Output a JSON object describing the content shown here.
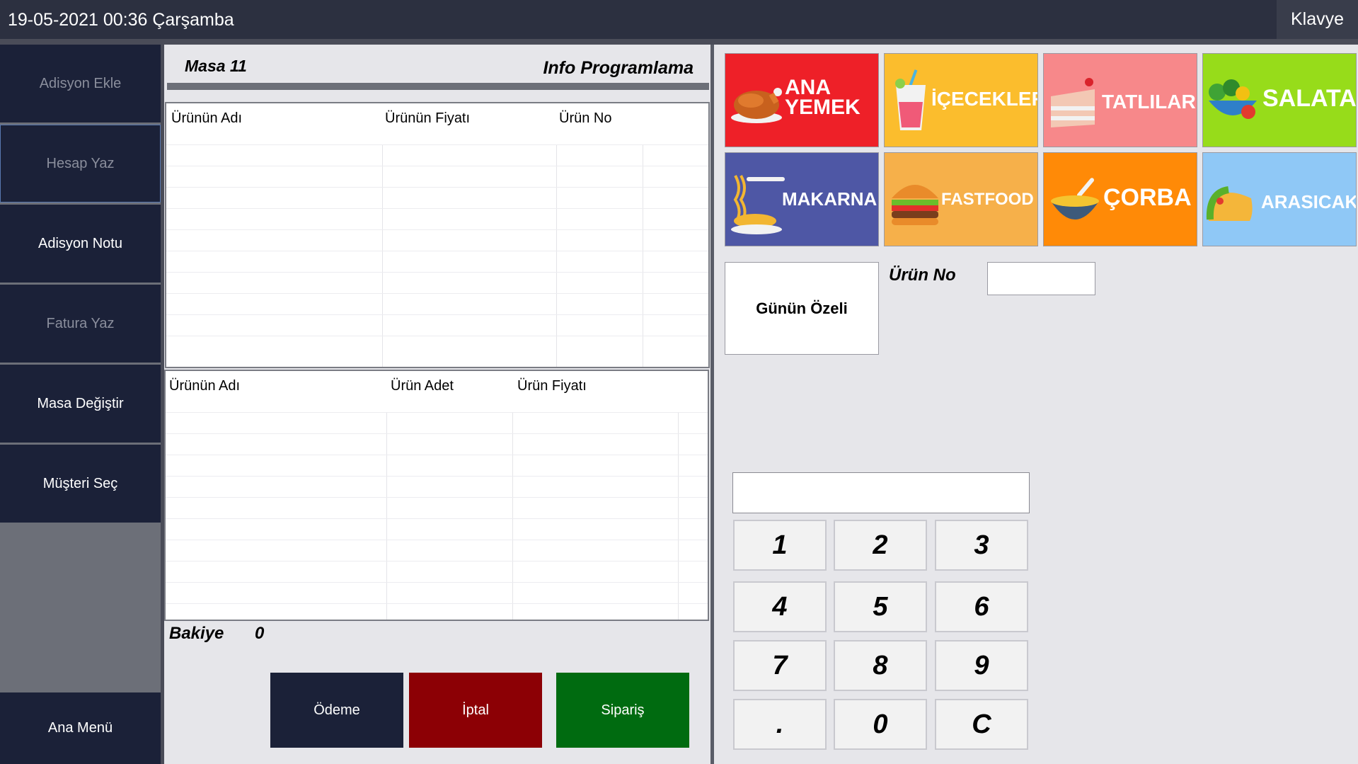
{
  "topbar": {
    "datetime": "19-05-2021 00:36 Çarşamba",
    "keyboard_label": "Klavye"
  },
  "sidebar": {
    "items": [
      {
        "label": "Adisyon Ekle"
      },
      {
        "label": "Hesap Yaz"
      },
      {
        "label": "Adisyon Notu"
      },
      {
        "label": "Fatura Yaz"
      },
      {
        "label": "Masa Değiştir"
      },
      {
        "label": "Müşteri Seç"
      }
    ],
    "main_menu_label": "Ana Menü"
  },
  "info": {
    "table": "Masa 11",
    "company": "Info Programlama"
  },
  "products_grid": {
    "columns": [
      "Ürünün Adı",
      "Ürünün Fiyatı",
      "Ürün No"
    ]
  },
  "order_grid": {
    "columns": [
      "Ürünün Adı",
      "Ürün Adet",
      "Ürün Fiyatı"
    ]
  },
  "balance": {
    "label": "Bakiye",
    "value": "0"
  },
  "actions": {
    "payment": "Ödeme",
    "cancel": "İptal",
    "order": "Sipariş"
  },
  "categories": [
    {
      "label_line1": "ANA",
      "label_line2": "YEMEK",
      "color": "#ee2028",
      "icon": "roast-chicken-icon"
    },
    {
      "label": "İÇECEKLER",
      "color": "#fbbd2d",
      "icon": "drink-icon"
    },
    {
      "label": "TATLILAR",
      "color": "#f7888a",
      "icon": "cake-icon"
    },
    {
      "label": "SALATA",
      "color": "#97dc1a",
      "icon": "salad-icon"
    },
    {
      "label": "MAKARNA",
      "color": "#4e57a5",
      "icon": "noodles-icon"
    },
    {
      "label": "FASTFOOD",
      "color": "#f6b04a",
      "icon": "burger-icon"
    },
    {
      "label": "ÇORBA",
      "color": "#ff8a07",
      "icon": "soup-icon"
    },
    {
      "label": "ARASICAK",
      "color": "#8fc8f6",
      "icon": "taco-icon"
    }
  ],
  "special_label": "Günün Özeli",
  "product_no_label": "Ürün No",
  "keypad": [
    "1",
    "2",
    "3",
    "4",
    "5",
    "6",
    "7",
    "8",
    "9",
    ".",
    "0",
    "C"
  ]
}
